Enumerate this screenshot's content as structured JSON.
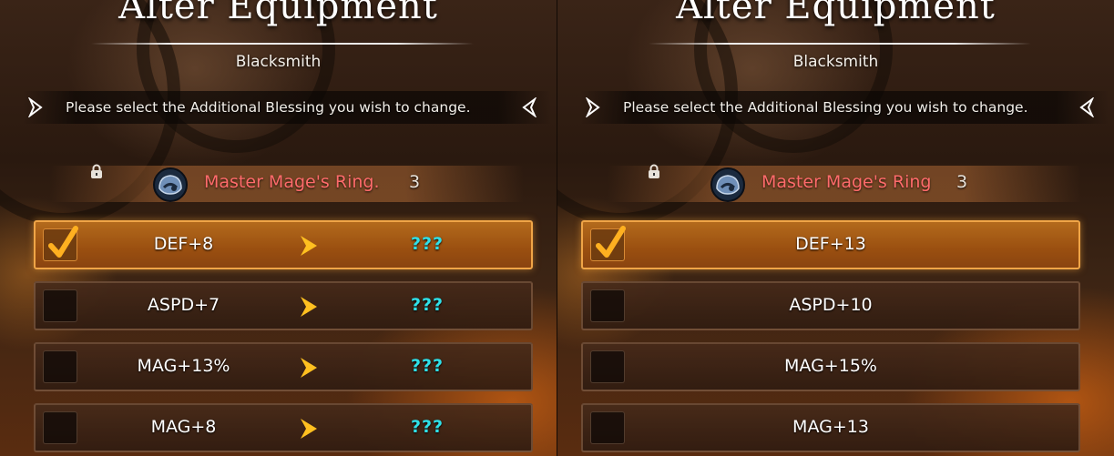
{
  "panels": [
    {
      "title": "Alter Equipment",
      "subtitle": "Blacksmith",
      "instruction": "Please select the Additional Blessing you wish to change.",
      "item": {
        "name": "Master Mage's Ring.",
        "count": "3",
        "icon": "ring-icon"
      },
      "rows": [
        {
          "stat": "DEF+8",
          "result": "???",
          "checked": true
        },
        {
          "stat": "ASPD+7",
          "result": "???",
          "checked": false
        },
        {
          "stat": "MAG+13%",
          "result": "???",
          "checked": false
        },
        {
          "stat": "MAG+8",
          "result": "???",
          "checked": false
        }
      ]
    },
    {
      "title": "Alter Equipment",
      "subtitle": "Blacksmith",
      "instruction": "Please select the Additional Blessing you wish to change.",
      "item": {
        "name": "Master Mage's Ring",
        "count": "3",
        "icon": "ring-icon"
      },
      "rows": [
        {
          "stat": "DEF+13",
          "checked": true
        },
        {
          "stat": "ASPD+10",
          "checked": false
        },
        {
          "stat": "MAG+15%",
          "checked": false
        },
        {
          "stat": "MAG+13",
          "checked": false
        }
      ]
    }
  ],
  "colors": {
    "accent": "#f0a547",
    "item_name": "#ff6b6b",
    "unknown": "#2fe0e8"
  }
}
